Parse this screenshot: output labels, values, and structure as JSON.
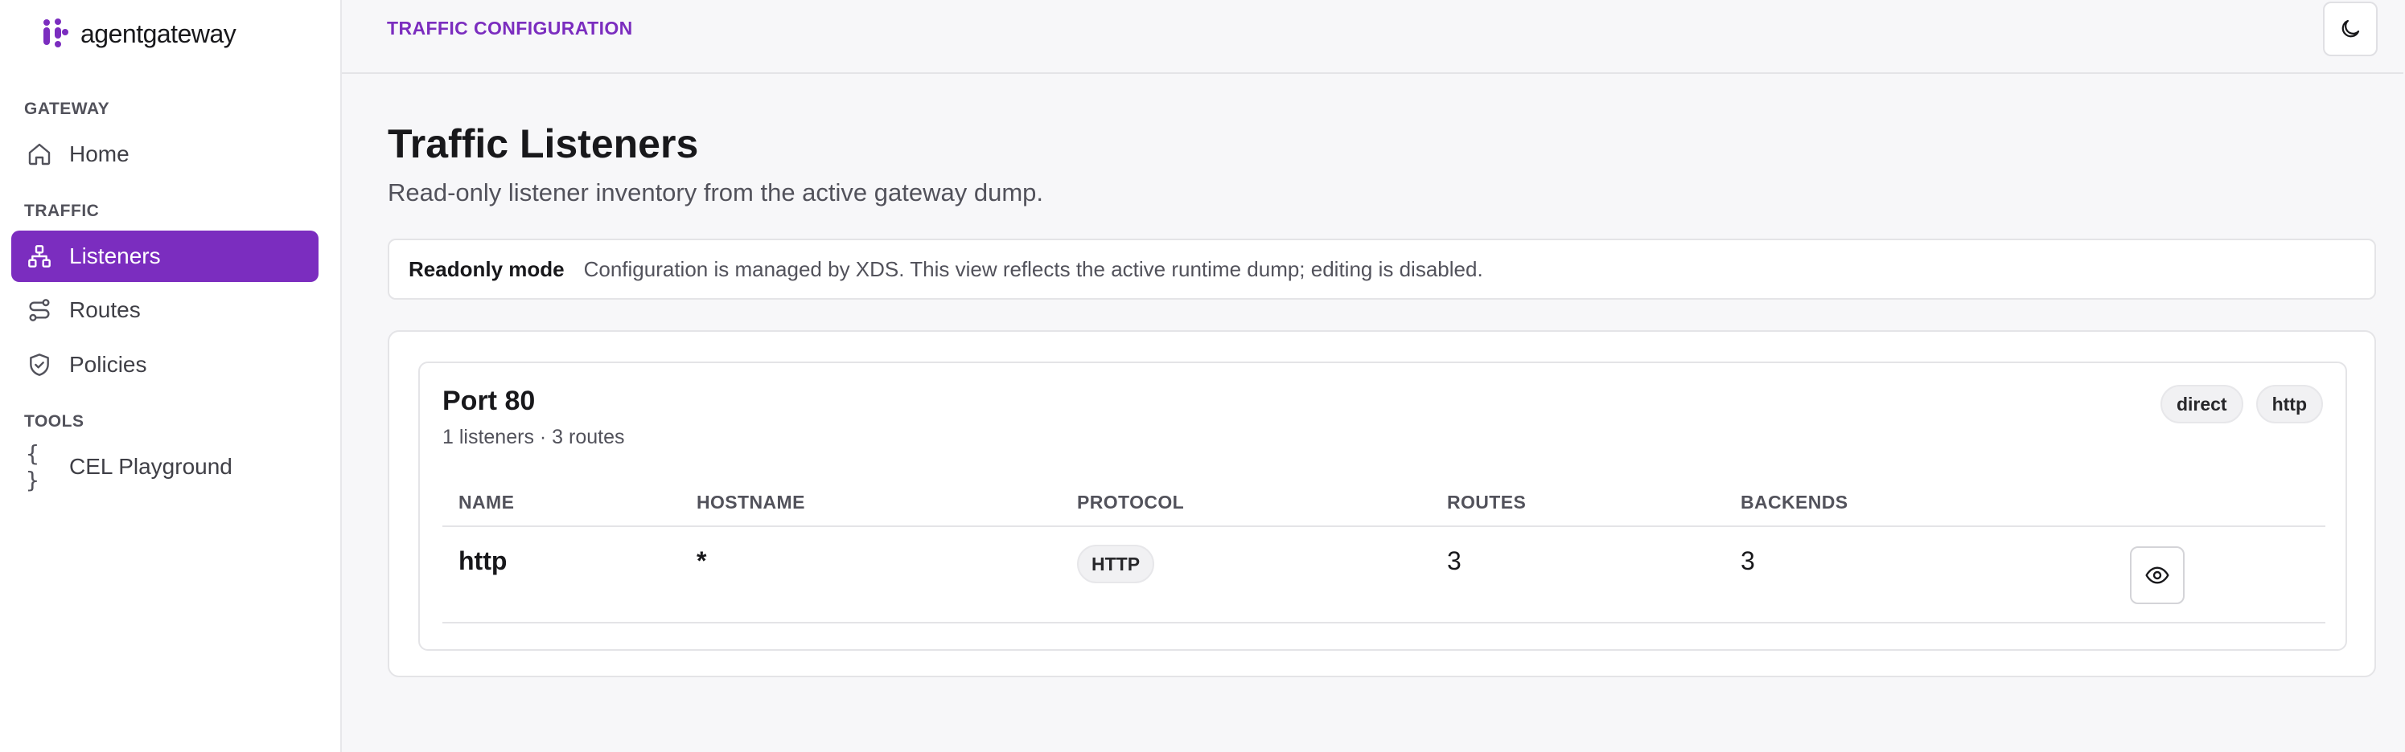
{
  "brand": {
    "name": "agentgateway",
    "accent": "#7b2dbf"
  },
  "sidebar": {
    "sections": [
      {
        "label": "GATEWAY"
      },
      {
        "label": "TRAFFIC"
      },
      {
        "label": "TOOLS"
      }
    ],
    "items": [
      {
        "label": "Home",
        "icon": "home-icon",
        "active": false
      },
      {
        "label": "Listeners",
        "icon": "network-icon",
        "active": true
      },
      {
        "label": "Routes",
        "icon": "route-icon",
        "active": false
      },
      {
        "label": "Policies",
        "icon": "shield-check-icon",
        "active": false
      },
      {
        "label": "CEL Playground",
        "icon": "braces-icon",
        "active": false
      }
    ],
    "cel_icon_glyph": "{ }"
  },
  "header": {
    "section_title": "TRAFFIC CONFIGURATION",
    "theme_toggle_icon": "moon-icon"
  },
  "page": {
    "title": "Traffic Listeners",
    "subtitle": "Read-only listener inventory from the active gateway dump."
  },
  "notice": {
    "title": "Readonly mode",
    "text": "Configuration is managed by XDS. This view reflects the active runtime dump; editing is disabled."
  },
  "port_card": {
    "title": "Port 80",
    "meta": "1 listeners · 3 routes",
    "chips": [
      "direct",
      "http"
    ],
    "table": {
      "columns": [
        "NAME",
        "HOSTNAME",
        "PROTOCOL",
        "ROUTES",
        "BACKENDS"
      ],
      "rows": [
        {
          "name": "http",
          "hostname": "*",
          "protocol": "HTTP",
          "routes": "3",
          "backends": "3",
          "action_icon": "eye-icon"
        }
      ]
    }
  }
}
